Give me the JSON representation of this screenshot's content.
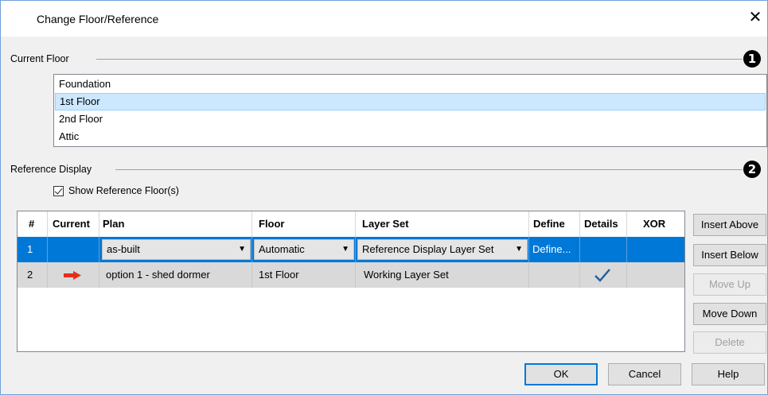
{
  "window": {
    "title": "Change Floor/Reference",
    "close_glyph": "✕"
  },
  "current_floor": {
    "label": "Current Floor",
    "callout": "1",
    "floors": [
      "Foundation",
      "1st Floor",
      "2nd Floor",
      "Attic"
    ],
    "selected": "1st Floor"
  },
  "reference_display": {
    "label": "Reference Display",
    "callout": "2",
    "show_reference_label": "Show Reference Floor(s)",
    "show_reference_checked": true
  },
  "table": {
    "columns": [
      "#",
      "Current",
      "Plan",
      "Floor",
      "Layer Set",
      "Define",
      "Details",
      "XOR"
    ],
    "rows": [
      {
        "num": "1",
        "current": "",
        "plan": "as-built",
        "floor": "Automatic",
        "layer_set": "Reference Display Layer Set",
        "define": "Define...",
        "details": "",
        "xor": "",
        "selected": true
      },
      {
        "num": "2",
        "current": "arrow-right-icon",
        "plan": "option 1 - shed dormer",
        "floor": "1st Floor",
        "layer_set": "Working Layer Set",
        "define": "",
        "details": "check-icon",
        "xor": "",
        "selected": false
      }
    ]
  },
  "side_buttons": {
    "insert_above": "Insert Above",
    "insert_below": "Insert Below",
    "move_up": "Move Up",
    "move_down": "Move Down",
    "delete": "Delete"
  },
  "footer_buttons": {
    "ok": "OK",
    "cancel": "Cancel",
    "help": "Help"
  },
  "colors": {
    "selection_blue": "#0078d7",
    "list_selection": "#cce8ff",
    "arrow_red": "#e0301e",
    "check_blue": "#1f5f9f"
  }
}
